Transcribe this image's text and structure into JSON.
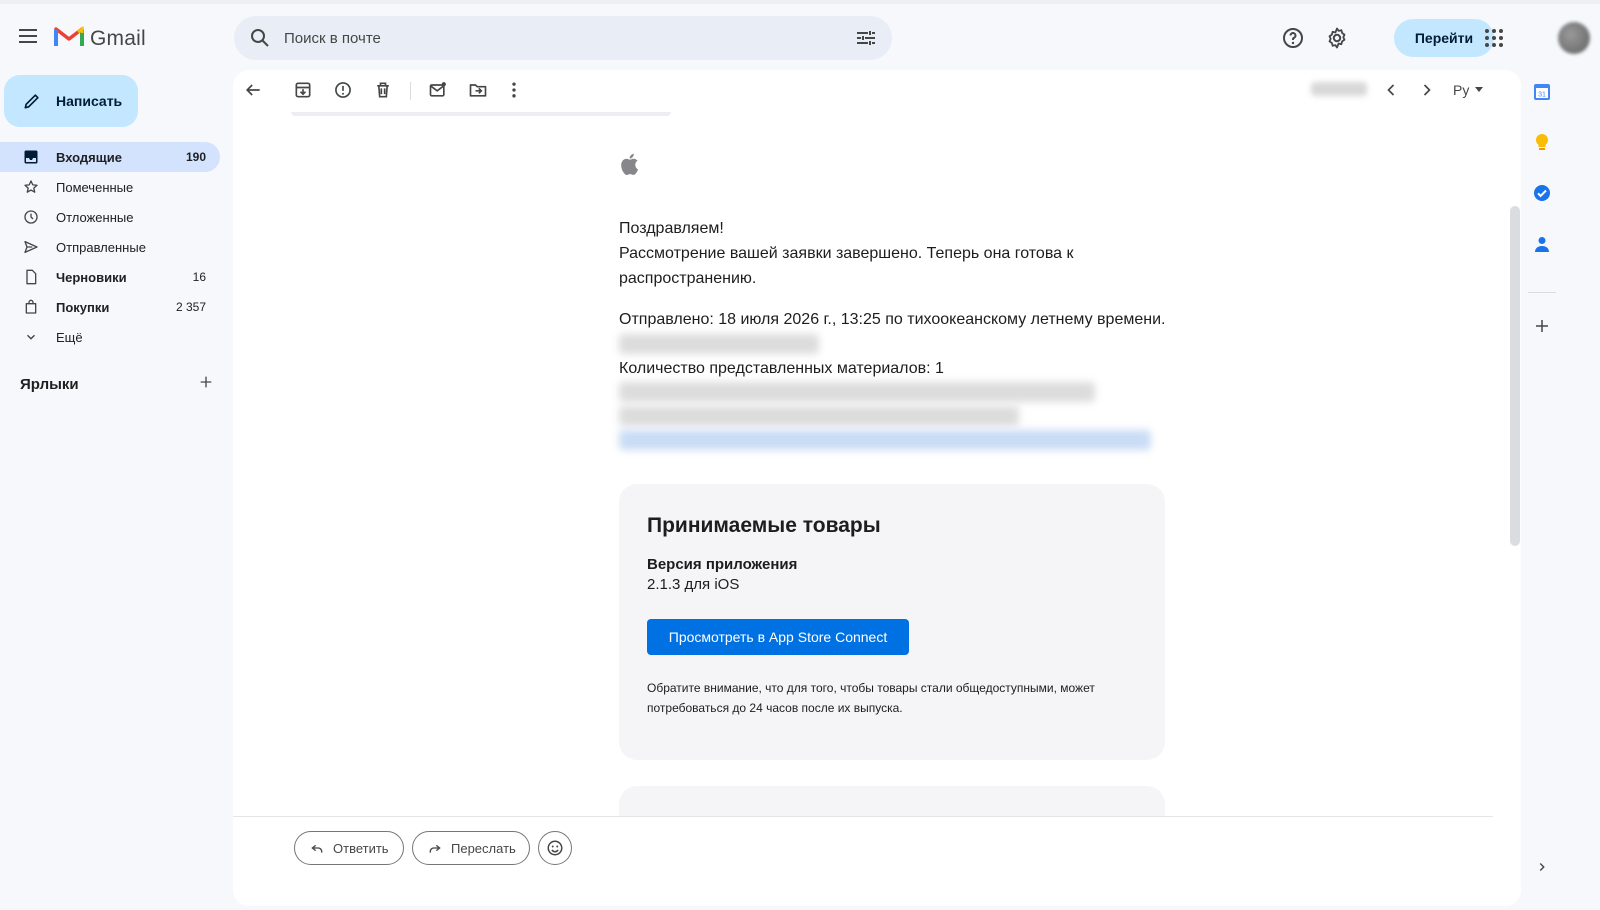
{
  "header": {
    "app_name": "Gmail",
    "search_placeholder": "Поиск в почте",
    "goto_label": "Перейти"
  },
  "sidebar": {
    "compose_label": "Написать",
    "items": [
      {
        "label": "Входящие",
        "count": "190"
      },
      {
        "label": "Помеченные",
        "count": ""
      },
      {
        "label": "Отложенные",
        "count": ""
      },
      {
        "label": "Отправленные",
        "count": ""
      },
      {
        "label": "Черновики",
        "count": "16"
      },
      {
        "label": "Покупки",
        "count": "2 357"
      },
      {
        "label": "Ещё",
        "count": ""
      }
    ],
    "labels_title": "Ярлыки"
  },
  "toolbar": {
    "language": "Ру"
  },
  "email": {
    "greeting": "Поздравляем!",
    "review_line1": "Рассмотрение вашей заявки завершено. Теперь она готова к",
    "review_line2": "распространению.",
    "sent_line": "Отправлено: 18 июля 2026 г., 13:25 по тихоокеанскому летнему времени.",
    "count_line": "Количество представленных материалов: 1",
    "panel_title": "Принимаемые товары",
    "panel_subtitle": "Версия приложения",
    "panel_version": "2.1.3 для iOS",
    "panel_button": "Просмотреть в App Store Connect",
    "panel_note": "Обратите внимание, что для того, чтобы товары стали общедоступными, может потребоваться до 24 часов после их выпуска."
  },
  "actions": {
    "reply_label": "Ответить",
    "forward_label": "Переслать"
  },
  "colors": {
    "accent": "#c2e7ff",
    "active_nav": "#d3e3fd",
    "apple_blue": "#0071e3"
  }
}
